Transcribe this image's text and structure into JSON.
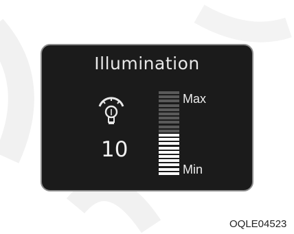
{
  "panel": {
    "title": "Illumination",
    "value": "10",
    "max_label": "Max",
    "min_label": "Min",
    "icon": "illumination-bulb-icon",
    "level": {
      "lit_segments": 10,
      "total_segments": 20
    }
  },
  "figure_code": "OQLE04523",
  "colors": {
    "panel_bg": "#1b1b1b",
    "panel_border": "#8d8d8d",
    "text": "#e8e8e8",
    "lit_segment": "#ffffff",
    "unlit_segment": "#5a5a5a",
    "watermark": "#f1f1f1"
  }
}
